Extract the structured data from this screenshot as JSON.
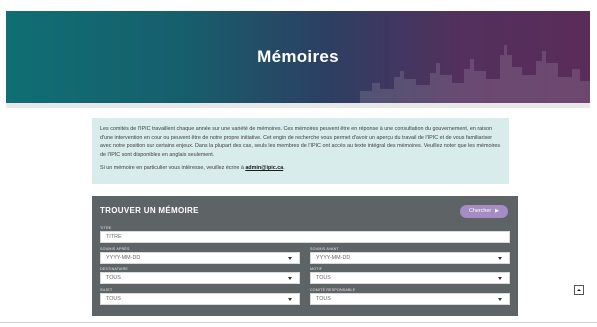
{
  "hero": {
    "title": "Mémoires"
  },
  "intro": {
    "paragraph1": "Les comités de l'IPIC travaillent chaque année sur une variété de mémoires. Ces mémoires peuvent être en réponse à une consultation du gouvernement, en raison d'une intervention en cour ou peuvent être de notre propre initiative. Cet engin de recherche vous permet d'avoir un aperçu du travail de l'IPIC et de vous familiariser avec notre position sur certains enjeux. Dans la plupart des cas, seuls les membres de l'IPIC ont accès au texte intégral des mémoires. Veuillez noter que les mémoires de l'IPIC sont disponibles en anglais seulement.",
    "paragraph2_prefix": "Si un mémoire en particulier vous intéresse, veuillez écrire à ",
    "email": "admin@ipic.ca",
    "paragraph2_suffix": "."
  },
  "finder": {
    "title": "TROUVER UN MÉMOIRE",
    "search_label": "Chercher",
    "fields": {
      "titre": {
        "label": "TITRE",
        "placeholder": "TITRE"
      },
      "soumis_apres": {
        "label": "SOUMIS APRÈS",
        "value": "YYYY-MM-DD"
      },
      "soumis_avant": {
        "label": "SOUMIS AVANT",
        "value": "YYYY-MM-DD"
      },
      "destinataire": {
        "label": "DESTINATAIRE",
        "value": "TOUS"
      },
      "motif": {
        "label": "MOTIF",
        "value": "TOUS"
      },
      "sujet": {
        "label": "SUJET",
        "value": "TOUS"
      },
      "comite": {
        "label": "COMITÉ RESPONSABLE",
        "value": "TOUS"
      }
    }
  },
  "colors": {
    "accent": "#a58cc4",
    "panel": "#5e6466",
    "info_bg": "#d7eceb"
  },
  "icons": {
    "scroll_top": "arrow-up-icon",
    "dropdown": "chevron-down-icon"
  }
}
